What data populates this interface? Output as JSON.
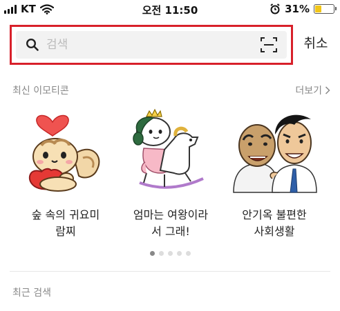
{
  "status_bar": {
    "carrier": "KT",
    "time": "오전 11:50",
    "battery_percent": "31%",
    "battery_level": 0.31,
    "icons": [
      "signal-icon",
      "wifi-icon",
      "alarm-icon",
      "battery-icon"
    ]
  },
  "search": {
    "placeholder": "검색",
    "value": "",
    "cancel_label": "취소",
    "highlight_color": "#d8202a"
  },
  "recent_emoticons": {
    "title": "최신 이모티콘",
    "more_label": "더보기",
    "items": [
      {
        "title": "숲 속의 귀요미\n람찌",
        "icon": "squirrel-heart-sticker"
      },
      {
        "title": "엄마는 여왕이라\n서 그래!",
        "icon": "queen-rocking-horse-sticker"
      },
      {
        "title": "안기옥 불편한\n사회생활",
        "icon": "two-men-sticker"
      }
    ],
    "page_count": 5,
    "current_page": 1
  },
  "recent_search": {
    "title": "최근 검색"
  }
}
